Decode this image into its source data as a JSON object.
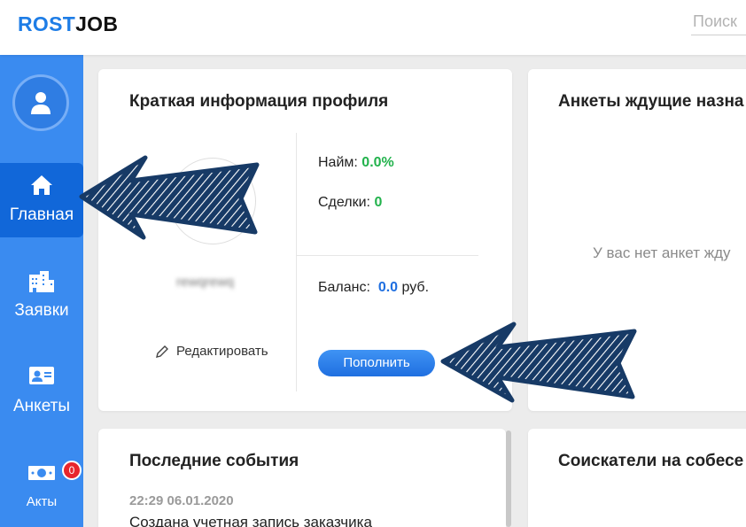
{
  "header": {
    "logo_part1": "ROST",
    "logo_part2": "JOB",
    "search_placeholder": "Поиск"
  },
  "sidebar": {
    "items": [
      {
        "label": "Главная",
        "icon": "home-icon",
        "active": true
      },
      {
        "label": "Заявки",
        "icon": "buildings-icon",
        "active": false
      },
      {
        "label": "Анкеты",
        "icon": "id-card-icon",
        "active": false
      },
      {
        "label": "Акты",
        "icon": "money-icon",
        "active": false,
        "badge": "0"
      }
    ]
  },
  "profile_card": {
    "title": "Краткая информация профиля",
    "username": "rewqrewq",
    "edit_label": "Редактировать",
    "hire_label": "Найм:",
    "hire_value": "0.0%",
    "deals_label": "Сделки:",
    "deals_value": "0",
    "balance_label": "Баланс:",
    "balance_value": "0.0",
    "balance_unit": "руб.",
    "topup_button": "Пополнить"
  },
  "pending_card": {
    "title": "Анкеты ждущие назна",
    "empty_text": "У вас нет анкет жду"
  },
  "events_card": {
    "title": "Последние события",
    "events": [
      {
        "time": "22:29 06.01.2020",
        "text": "Создана учетная запись заказчика"
      }
    ]
  },
  "interview_card": {
    "title": "Соискатели на собесе"
  },
  "colors": {
    "sidebar": "#3a8bf0",
    "sidebar_active": "#1167d9",
    "accent_blue": "#1f6fe0",
    "positive_green": "#22b24c",
    "badge_red": "#e8262c",
    "arrow_navy": "#173a66"
  }
}
